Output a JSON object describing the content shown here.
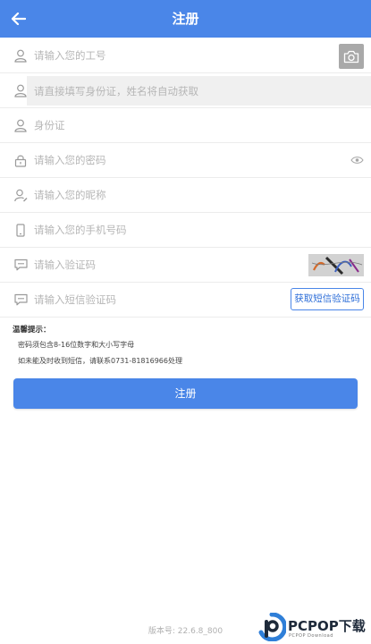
{
  "header": {
    "title": "注册"
  },
  "form": {
    "employee_id": {
      "placeholder": "请输入您的工号"
    },
    "name_hint": {
      "placeholder": "请直接填写身份证，姓名将自动获取"
    },
    "id_card": {
      "placeholder": "身份证"
    },
    "password": {
      "placeholder": "请输入您的密码"
    },
    "nickname": {
      "placeholder": "请输入您的昵称"
    },
    "phone": {
      "placeholder": "请输入您的手机号码"
    },
    "captcha": {
      "placeholder": "请输入验证码"
    },
    "sms_code": {
      "placeholder": "请输入短信验证码",
      "button_label": "获取短信验证码"
    }
  },
  "tips": {
    "title": "温馨提示：",
    "line1": "密码须包含8-16位数字和大小写字母",
    "line2": "如未能及时收到短信，请联系0731-81816966处理"
  },
  "register_button": {
    "label": "注册"
  },
  "footer": {
    "version": "版本号: 22.6.8_800"
  },
  "watermark": {
    "brand": "PCPOP下载",
    "sub": "PCPOP Download"
  },
  "colors": {
    "primary": "#4a86e8",
    "border": "#ececec",
    "placeholder": "#b6b6b6"
  }
}
